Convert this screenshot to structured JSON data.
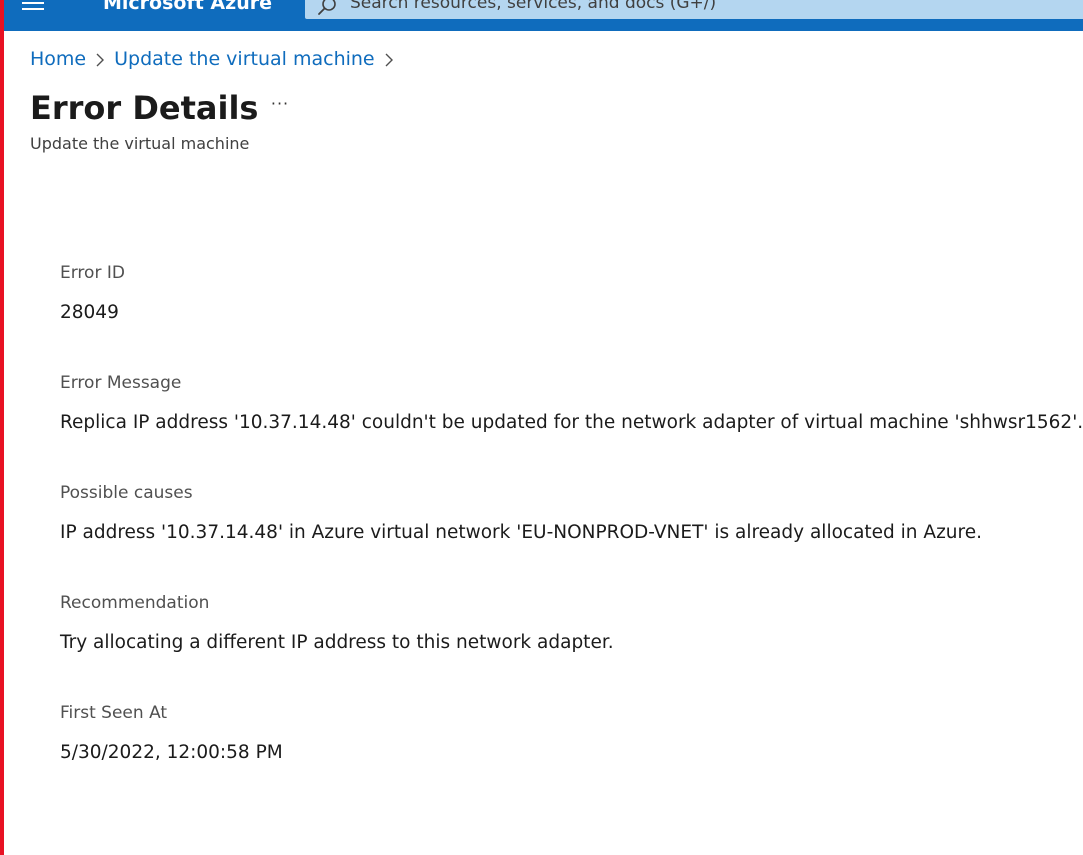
{
  "header": {
    "brand": "Microsoft Azure",
    "search_placeholder": "Search resources, services, and docs (G+/)",
    "menu_icon": "hamburger-menu-icon",
    "search_icon": "search-icon",
    "bar_color": "#0f6cbd"
  },
  "breadcrumb": {
    "items": [
      {
        "label": "Home"
      },
      {
        "label": "Update the virtual machine"
      }
    ],
    "separator_icon": "chevron-right-icon"
  },
  "page": {
    "title": "Error Details",
    "more_label": "···",
    "subtitle": "Update the virtual machine"
  },
  "details": [
    {
      "label": "Error ID",
      "value": "28049"
    },
    {
      "label": "Error Message",
      "value": "Replica IP address '10.37.14.48' couldn't be updated for the network adapter of  virtual machine 'shhwsr1562'."
    },
    {
      "label": "Possible causes",
      "value": "IP address '10.37.14.48' in Azure virtual network 'EU-NONPROD-VNET' is already allocated in Azure."
    },
    {
      "label": "Recommendation",
      "value": "Try allocating a different IP address to this network adapter."
    },
    {
      "label": "First Seen At",
      "value": "5/30/2022, 12:00:58 PM"
    }
  ],
  "colors": {
    "accent": "#0f6cbd",
    "window_border": "#e81123",
    "search_bg": "#b4d6f0"
  }
}
